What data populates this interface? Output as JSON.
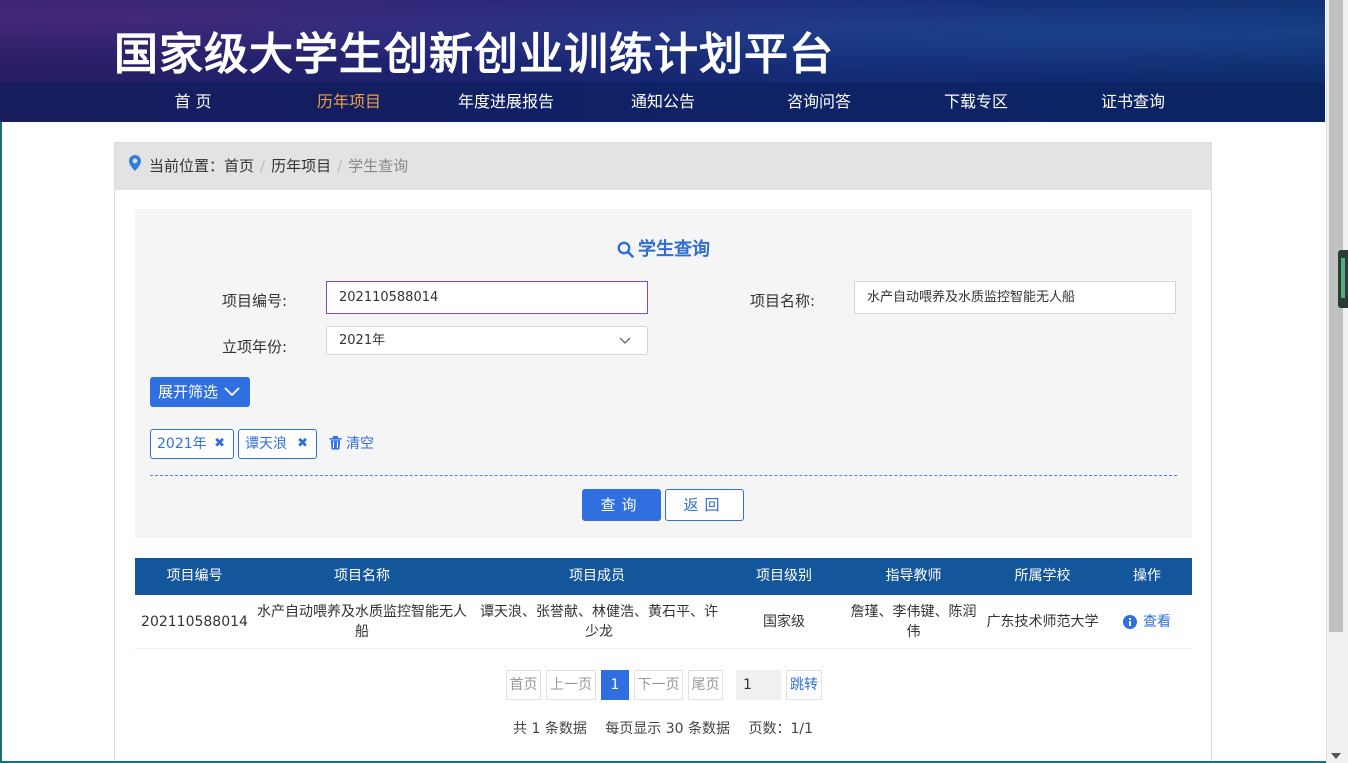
{
  "header": {
    "title": "国家级大学生创新创业训练计划平台",
    "nav": [
      {
        "label": "首 页",
        "active": false
      },
      {
        "label": "历年项目",
        "active": true
      },
      {
        "label": "年度进展报告",
        "active": false
      },
      {
        "label": "通知公告",
        "active": false
      },
      {
        "label": "咨询问答",
        "active": false
      },
      {
        "label": "下载专区",
        "active": false
      },
      {
        "label": "证书查询",
        "active": false
      }
    ]
  },
  "breadcrumb": {
    "prefix": "当前位置：",
    "home": "首页",
    "section": "历年项目",
    "current": "学生查询",
    "icon": "map-pin-icon"
  },
  "search": {
    "title": "学生查询",
    "project_number_label": "项目编号:",
    "project_number_value": "202110588014",
    "project_name_label": "项目名称:",
    "project_name_value": "水产自动喂养及水质监控智能无人船",
    "year_label": "立项年份:",
    "year_value": "2021年",
    "expand_label": "展开筛选",
    "tags": [
      "2021年",
      "谭天浪"
    ],
    "tag_remove_symbol": "✖",
    "clear_label": "清空",
    "query_label": "查询",
    "back_label": "返回"
  },
  "table": {
    "columns": [
      "项目编号",
      "项目名称",
      "项目成员",
      "项目级别",
      "指导教师",
      "所属学校",
      "操作"
    ],
    "rows": [
      {
        "number": "202110588014",
        "name": "水产自动喂养及水质监控智能无人船",
        "members": "谭天浪、张誉献、林健浩、黄石平、许少龙",
        "level": "国家级",
        "advisors": "詹瑾、李伟键、陈润伟",
        "school": "广东技术师范大学",
        "action": "查看"
      }
    ]
  },
  "pagination": {
    "first": "首页",
    "prev": "上一页",
    "current_page": "1",
    "next": "下一页",
    "last": "尾页",
    "jump_input": "1",
    "jump_label": "跳转",
    "total_text": "共 1 条数据",
    "per_page_text": "每页显示 30 条数据",
    "pages_text": "页数：1/1"
  },
  "colors": {
    "accent": "#2f6fe0",
    "nav_active": "#f0a040",
    "table_header": "#14569b"
  }
}
